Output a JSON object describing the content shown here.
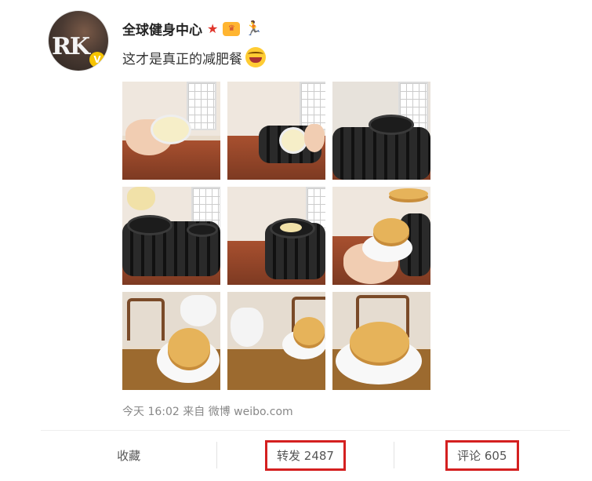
{
  "post": {
    "author": "全球健身中心",
    "avatar_text": "RK",
    "avatar_badge": "V",
    "text": "这才是真正的减肥餐",
    "timestamp": "今天 16:02",
    "source": "来自 微博 weibo.com"
  },
  "badges": [
    "star-badge-icon",
    "vip-badge-icon",
    "running-badge-icon"
  ],
  "actions": {
    "favorite": "收藏",
    "repost": "转发 2487",
    "comment": "评论 605"
  },
  "colors": {
    "highlight_border": "#d42020",
    "star": "#e0352b",
    "run_icon": "#27b34a"
  }
}
